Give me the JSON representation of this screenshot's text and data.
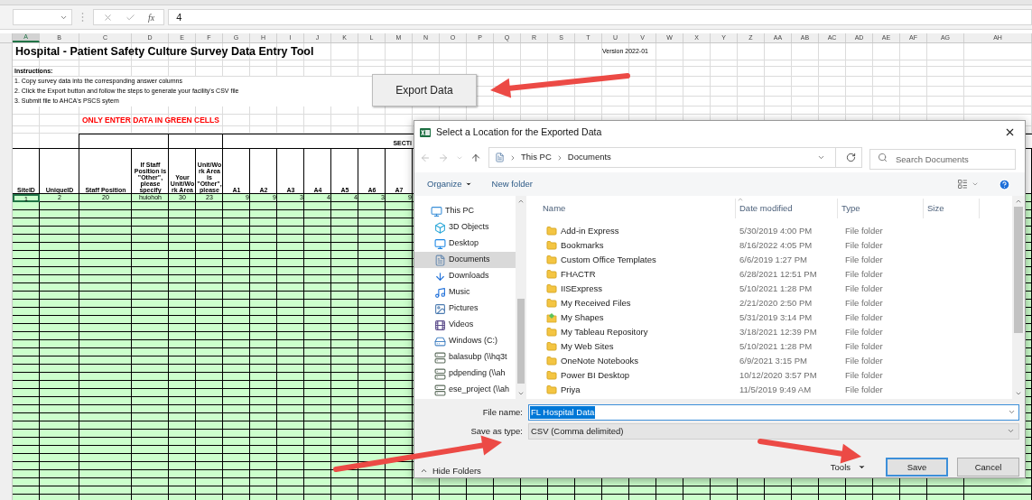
{
  "formula_bar": {
    "function_label": "fx",
    "value": "4"
  },
  "column_headers": [
    {
      "label": "A",
      "selected": true
    },
    {
      "label": "B",
      "selected": false
    },
    {
      "label": "C",
      "selected": false
    },
    {
      "label": "D",
      "selected": false
    },
    {
      "label": "E",
      "selected": false
    },
    {
      "label": "F",
      "selected": false
    },
    {
      "label": "G",
      "selected": false
    },
    {
      "label": "H",
      "selected": false
    },
    {
      "label": "I",
      "selected": false
    },
    {
      "label": "J",
      "selected": false
    },
    {
      "label": "K",
      "selected": false
    },
    {
      "label": "L",
      "selected": false
    },
    {
      "label": "M",
      "selected": false
    },
    {
      "label": "N",
      "selected": false
    },
    {
      "label": "O",
      "selected": false
    },
    {
      "label": "P",
      "selected": false
    },
    {
      "label": "Q",
      "selected": false
    },
    {
      "label": "R",
      "selected": false
    },
    {
      "label": "S",
      "selected": false
    },
    {
      "label": "T",
      "selected": false
    },
    {
      "label": "U",
      "selected": false
    },
    {
      "label": "V",
      "selected": false
    },
    {
      "label": "W",
      "selected": false
    },
    {
      "label": "X",
      "selected": false
    },
    {
      "label": "Y",
      "selected": false
    },
    {
      "label": "Z",
      "selected": false
    },
    {
      "label": "AA",
      "selected": false
    },
    {
      "label": "AB",
      "selected": false
    },
    {
      "label": "AC",
      "selected": false
    },
    {
      "label": "AD",
      "selected": false
    },
    {
      "label": "AE",
      "selected": false
    },
    {
      "label": "AF",
      "selected": false
    },
    {
      "label": "AG",
      "selected": false
    },
    {
      "label": "AH",
      "selected": false
    }
  ],
  "sheet": {
    "title": "Hospital - Patient Safety Culture Survey Data Entry Tool",
    "version": "Version 2022-01",
    "instructions_heading": "Instructions:",
    "instructions": [
      "1.  Copy survey data into the corresponding answer columns",
      "2.  Click the Export button and follow the steps to generate your facility's CSV file",
      "3.  Submit file to AHCA's PSCS sytem"
    ],
    "warning": "ONLY ENTER DATA IN GREEN CELLS",
    "section_label": "SECTI",
    "column_headings": [
      "SiteID",
      "UniqueID",
      "Staff Position",
      "If Staff Position is \"Other\", please specify",
      "Your Unit/Work Area",
      "Unit/Work Area is \"Other\", please",
      "A1",
      "A2",
      "A3",
      "A4",
      "A5",
      "A6",
      "A7"
    ],
    "data_row": [
      {
        "value": "1",
        "selected": true
      },
      {
        "value": "2",
        "selected": false
      },
      {
        "value": "20",
        "selected": false
      },
      {
        "value": "huiohoh",
        "selected": false
      },
      {
        "value": "30",
        "selected": false
      },
      {
        "value": "23",
        "selected": false
      },
      {
        "value": "9",
        "selected": false
      },
      {
        "value": "9",
        "selected": false
      },
      {
        "value": "3",
        "selected": false
      },
      {
        "value": "4",
        "selected": false
      },
      {
        "value": "4",
        "selected": false
      },
      {
        "value": "3",
        "selected": false
      },
      {
        "value": "9",
        "selected": false
      }
    ]
  },
  "export_button": "Export Data",
  "dialog": {
    "title": "Select a Location for the Exported Data",
    "path": [
      "This PC",
      "Documents"
    ],
    "search_placeholder": "Search Documents",
    "organize": "Organize",
    "new_folder": "New folder",
    "nav_items": [
      {
        "label": "This PC",
        "kind": "pc",
        "selected": false,
        "children": [
          {
            "label": "3D Objects",
            "kind": "cube",
            "selected": false
          },
          {
            "label": "Desktop",
            "kind": "desktop",
            "selected": false
          },
          {
            "label": "Documents",
            "kind": "documents",
            "selected": true
          },
          {
            "label": "Downloads",
            "kind": "download",
            "selected": false
          },
          {
            "label": "Music",
            "kind": "music",
            "selected": false
          },
          {
            "label": "Pictures",
            "kind": "pictures",
            "selected": false
          },
          {
            "label": "Videos",
            "kind": "videos",
            "selected": false
          },
          {
            "label": "Windows (C:)",
            "kind": "drive",
            "selected": false
          },
          {
            "label": "balasubp (\\\\hq3t",
            "kind": "network",
            "selected": false
          },
          {
            "label": "pdpending (\\\\ah",
            "kind": "network",
            "selected": false
          },
          {
            "label": "ese_project (\\\\ah",
            "kind": "network",
            "selected": false
          }
        ]
      }
    ],
    "columns": [
      "Name",
      "Date modified",
      "Type",
      "Size"
    ],
    "files": [
      {
        "name": "Add-in Express",
        "date": "5/30/2019 4:00 PM",
        "type": "File folder",
        "kind": "folder"
      },
      {
        "name": "Bookmarks",
        "date": "8/16/2022 4:05 PM",
        "type": "File folder",
        "kind": "folder"
      },
      {
        "name": "Custom Office Templates",
        "date": "6/6/2019 1:27 PM",
        "type": "File folder",
        "kind": "folder"
      },
      {
        "name": "FHACTR",
        "date": "6/28/2021 12:51 PM",
        "type": "File folder",
        "kind": "folder"
      },
      {
        "name": "IISExpress",
        "date": "5/10/2021 1:28 PM",
        "type": "File folder",
        "kind": "folder"
      },
      {
        "name": "My Received Files",
        "date": "2/21/2020 2:50 PM",
        "type": "File folder",
        "kind": "folder"
      },
      {
        "name": "My Shapes",
        "date": "5/31/2019 3:14 PM",
        "type": "File folder",
        "kind": "shapes"
      },
      {
        "name": "My Tableau Repository",
        "date": "3/18/2021 12:39 PM",
        "type": "File folder",
        "kind": "folder"
      },
      {
        "name": "My Web Sites",
        "date": "5/10/2021 1:28 PM",
        "type": "File folder",
        "kind": "folder"
      },
      {
        "name": "OneNote Notebooks",
        "date": "6/9/2021 3:15 PM",
        "type": "File folder",
        "kind": "folder"
      },
      {
        "name": "Power BI Desktop",
        "date": "10/12/2020 3:57 PM",
        "type": "File folder",
        "kind": "folder"
      },
      {
        "name": "Priya",
        "date": "11/5/2019 9:49 AM",
        "type": "File folder",
        "kind": "folder"
      }
    ],
    "file_name_label": "File name:",
    "file_name": {
      "value": "FL Hospital Data",
      "highlighted": true
    },
    "save_as_type_label": "Save as type:",
    "save_as_type": "CSV (Comma delimited)",
    "hide_folders": "Hide Folders",
    "tools": "Tools",
    "buttons": [
      {
        "label": "Save",
        "default": true
      },
      {
        "label": "Cancel",
        "default": false
      }
    ]
  }
}
